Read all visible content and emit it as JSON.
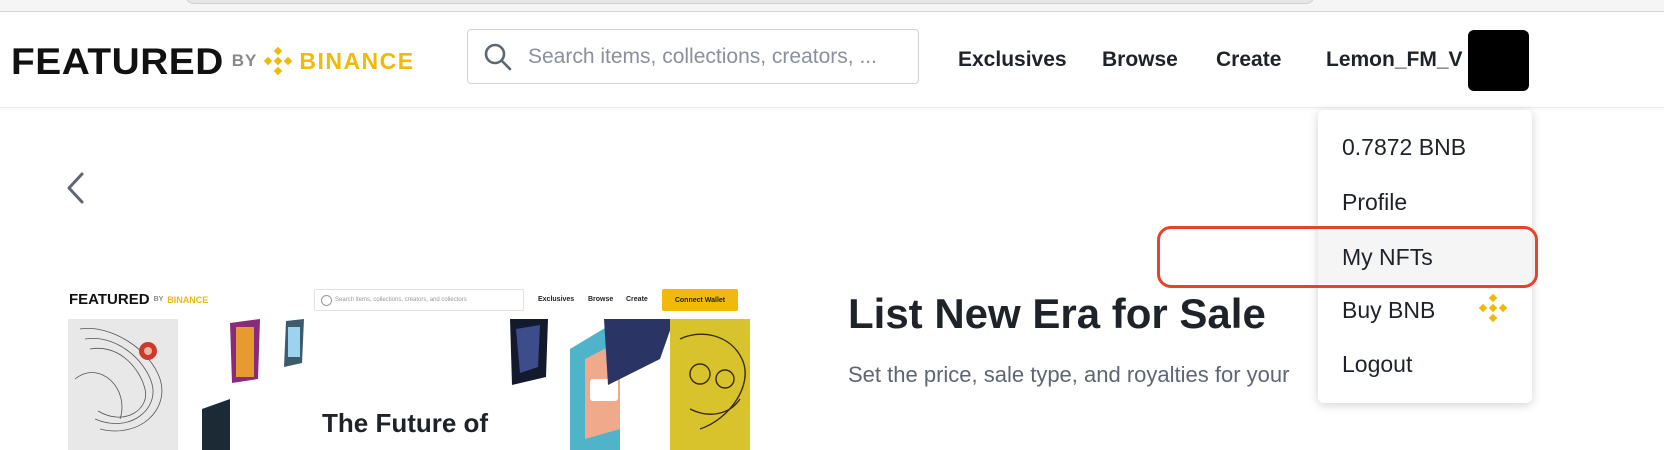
{
  "header": {
    "logo_featured": "FEATURED",
    "logo_by": "BY",
    "logo_binance": "BINANCE",
    "search_placeholder": "Search items, collections, creators, ...",
    "nav": {
      "exclusives": "Exclusives",
      "browse": "Browse",
      "create": "Create",
      "username": "Lemon_FM_V"
    }
  },
  "preview": {
    "logo_featured": "FEATURED",
    "logo_by": "BY",
    "logo_binance": "BINANCE",
    "search_placeholder": "Search items, collections, creators, and collectors",
    "nav": [
      "Exclusives",
      "Browse",
      "Create"
    ],
    "connect_wallet": "Connect Wallet",
    "headline": "The Future of"
  },
  "listing": {
    "title": "List New Era for Sale",
    "subtitle": "Set the price, sale type, and royalties for your"
  },
  "dropdown": {
    "balance": "0.7872 BNB",
    "profile": "Profile",
    "my_nfts": "My NFTs",
    "buy_bnb": "Buy BNB",
    "logout": "Logout"
  },
  "colors": {
    "brand_yellow": "#F0B90B",
    "highlight_red": "#E2452B",
    "text_primary": "#1E2329",
    "text_secondary": "#5E6673"
  },
  "icons": {
    "search": "search-icon",
    "back": "chevron-left-icon",
    "binance": "binance-logo-icon",
    "avatar": "avatar"
  }
}
